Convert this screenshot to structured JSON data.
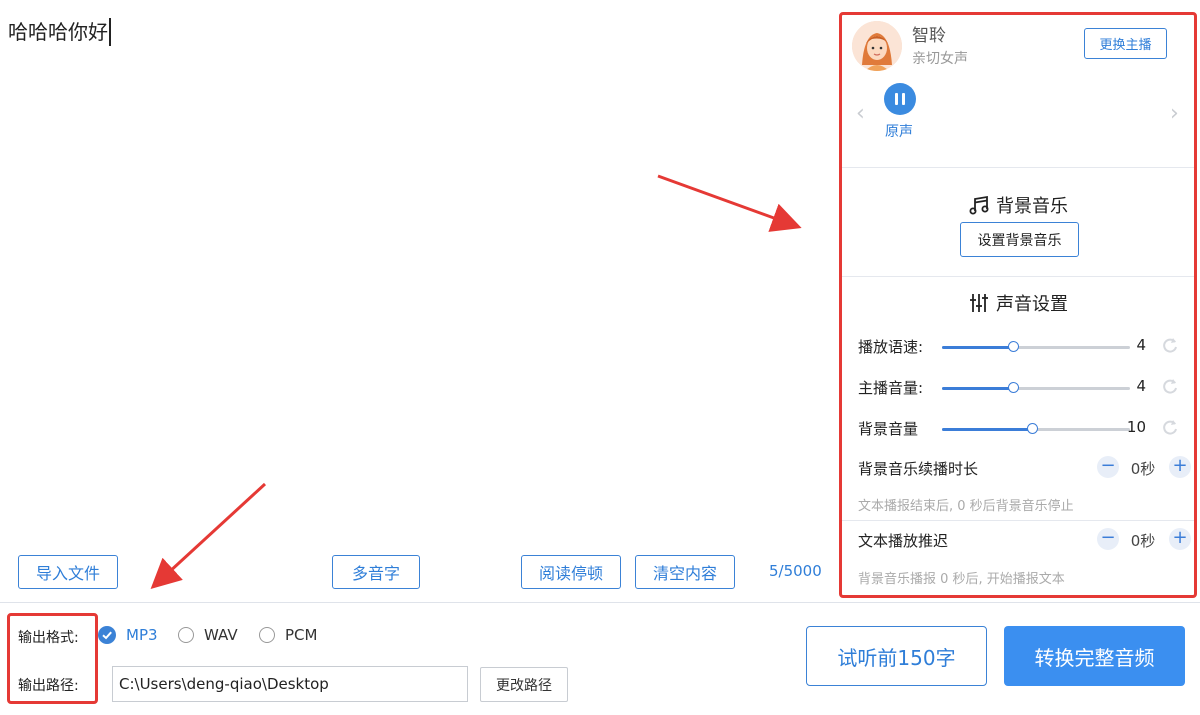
{
  "editor": {
    "text": "哈哈哈你好"
  },
  "toolbar": {
    "import_label": "导入文件",
    "polyphone_label": "多音字",
    "pause_label": "阅读停顿",
    "clear_label": "清空内容",
    "counter": "5/5000"
  },
  "output": {
    "format_label": "输出格式:",
    "path_label": "输出路径:",
    "formats": [
      "MP3",
      "WAV",
      "PCM"
    ],
    "selected_format": "MP3",
    "path_value": "C:\\Users\\deng-qiao\\Desktop",
    "change_path_label": "更改路径"
  },
  "actions": {
    "preview_label": "试听前150字",
    "convert_label": "转换完整音频"
  },
  "panel": {
    "anchor_name": "智聆",
    "anchor_desc": "亲切女声",
    "change_anchor_label": "更换主播",
    "voice_label": "原声",
    "bg_music_title": "背景音乐",
    "set_bg_music_label": "设置背景音乐",
    "voice_settings_title": "声音设置",
    "sliders": [
      {
        "label": "播放语速:",
        "value": "4",
        "fraction": 0.38
      },
      {
        "label": "主播音量:",
        "value": "4",
        "fraction": 0.38
      },
      {
        "label": "背景音量",
        "value": "10",
        "fraction": 0.48
      }
    ],
    "bg_duration_label": "背景音乐续播时长",
    "bg_duration_value": "0秒",
    "bg_duration_hint": "文本播报结束后, 0 秒后背景音乐停止",
    "text_delay_label": "文本播放推迟",
    "text_delay_value": "0秒",
    "text_delay_hint": "背景音乐播报 0 秒后, 开始播报文本"
  },
  "colors": {
    "accent": "#2f7ed8",
    "primary_button": "#3b8ff0",
    "highlight_border": "#e53935"
  }
}
